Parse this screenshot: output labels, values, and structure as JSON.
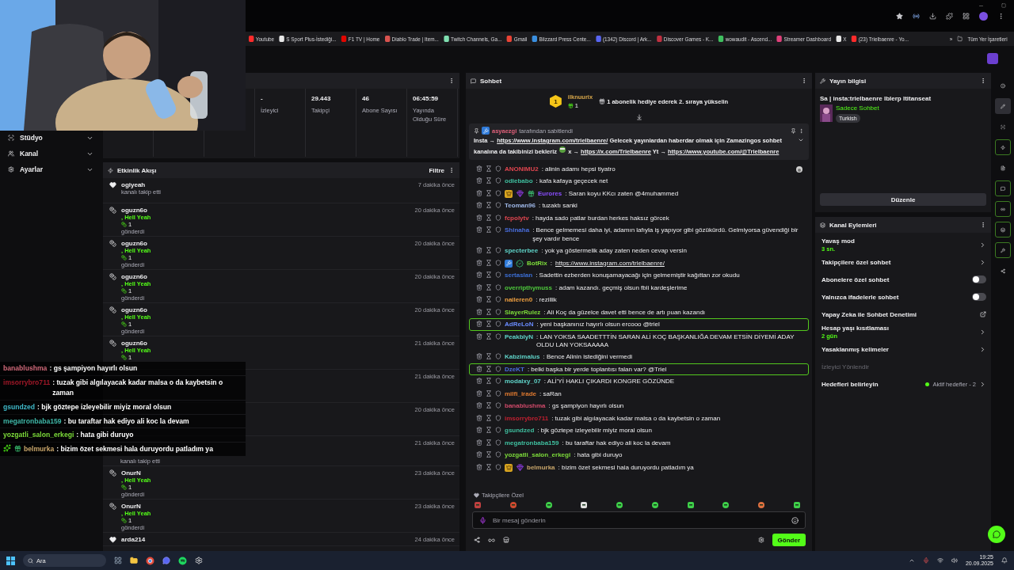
{
  "browser": {
    "bookmarks": [
      {
        "label": "Youtube",
        "color": "#ff2b2b"
      },
      {
        "label": "S Sport Plus-İstediği...",
        "color": "#e8e8e8"
      },
      {
        "label": "F1 TV | Home",
        "color": "#e10600"
      },
      {
        "label": "Diablo Trade | Item...",
        "color": "#d9534f"
      },
      {
        "label": "Twitch Channels, Ga...",
        "color": "#7fdfb0"
      },
      {
        "label": "Gmail",
        "color": "#ea4335"
      },
      {
        "label": "Blizzard Press Cente...",
        "color": "#3a8fe0"
      },
      {
        "label": "(1342) Discord | Ark...",
        "color": "#5865f2"
      },
      {
        "label": "Discover Games - K...",
        "color": "#c03040"
      },
      {
        "label": "wowaudit - Ascend...",
        "color": "#3fbf5f"
      },
      {
        "label": "Streamer Dashboard",
        "color": "#e0407a"
      },
      {
        "label": "X",
        "color": "#e8e8e8"
      },
      {
        "label": "(23) Trielbaenre - Yo...",
        "color": "#ff2b2b"
      }
    ],
    "more": "»",
    "all_bookmarks": "Tüm Yer İşaretleri"
  },
  "nav": [
    {
      "kind": "studio",
      "label": "Stüdyo"
    },
    {
      "kind": "channel",
      "label": "Kanal"
    },
    {
      "kind": "settings",
      "label": "Ayarlar"
    }
  ],
  "stats": [
    {
      "value": "-",
      "label": "İzleyici"
    },
    {
      "value": "29.443",
      "label": "Takipçi"
    },
    {
      "value": "46",
      "label": "Abone Sayısı"
    },
    {
      "value": "06:45:59",
      "label": "Yayında Olduğu Süre"
    }
  ],
  "activity": {
    "title": "Etkinlik Akışı",
    "filter": "Filtre",
    "items": [
      {
        "kind": "follow",
        "name": "ogiyeah",
        "note": "kanalı takip etti",
        "time": "7 dakika önce"
      },
      {
        "kind": "gift",
        "name": "oguzn6o",
        "reward": ", Hell Yeah",
        "count": "1",
        "note": "gönderdi",
        "time": "20 dakika önce"
      },
      {
        "kind": "gift",
        "name": "oguzn6o",
        "reward": ", Hell Yeah",
        "count": "1",
        "note": "gönderdi",
        "time": "20 dakika önce"
      },
      {
        "kind": "gift",
        "name": "oguzn6o",
        "reward": ", Hell Yeah",
        "count": "1",
        "note": "gönderdi",
        "time": "20 dakika önce"
      },
      {
        "kind": "gift",
        "name": "oguzn6o",
        "reward": ", Hell Yeah",
        "count": "1",
        "note": "gönderdi",
        "time": "20 dakika önce"
      },
      {
        "kind": "gift",
        "name": "oguzn6o",
        "reward": ", Hell Yeah",
        "count": "1",
        "time": "21 dakika önce"
      },
      {
        "kind": "covered",
        "time": "21 dakika önce"
      },
      {
        "kind": "covered",
        "time": "20 dakika önce"
      },
      {
        "kind": "covered",
        "time": "21 dakika önce",
        "note": "kanalı takip etti"
      },
      {
        "kind": "gift",
        "name": "OnurN",
        "reward": ", Hell Yeah",
        "count": "1",
        "note": "gönderdi",
        "time": "23 dakika önce"
      },
      {
        "kind": "gift",
        "name": "OnurN",
        "reward": ", Hell Yeah",
        "count": "1",
        "note": "gönderdi",
        "time": "23 dakika önce"
      },
      {
        "kind": "cut",
        "name": "arda214",
        "time": "24 dakika önce"
      }
    ]
  },
  "chat": {
    "title": "Sohbet",
    "leader": {
      "rank": "1",
      "name": "ilknuurix",
      "count": "1",
      "prompt": "1 abonelik hediye ederek 2. sıraya yükselin"
    },
    "pinned": {
      "by": "asyaezgi",
      "note": "tarafından sabitlendi",
      "segments": [
        {
          "kind": "text",
          "text": "Insta → "
        },
        {
          "kind": "link",
          "text": "https://www.instagram.com/trielbaenre/"
        },
        {
          "kind": "text",
          "text": " Gelecek yayınlardan haberdar olmak için Zamazingos sohbet kanalına da takibinizi bekleriz "
        },
        {
          "kind": "emote"
        },
        {
          "kind": "text",
          "text": " x → "
        },
        {
          "kind": "link",
          "text": "https://x.com/Trielbaenre"
        },
        {
          "kind": "text",
          "text": " Yt → "
        },
        {
          "kind": "link",
          "text": "https://www.youtube.com/@Trielbaenre"
        }
      ]
    },
    "messages": [
      {
        "user": "ANONIMU2",
        "color": "#e0454f",
        "text": ": alinin adamı hepsi tiyatro",
        "emote": true,
        "highlighted": false
      },
      {
        "user": "odiebabo",
        "color": "#3fbf9f",
        "text": ": kafa kafaya geçecek net",
        "highlighted": false
      },
      {
        "user": "Eurores",
        "color": "#8a4dff",
        "text": ": Saran koyu KKcı zaten @4muhammed",
        "badges": [
          {
            "kind": "crown"
          },
          {
            "kind": "gem"
          },
          {
            "kind": "gift"
          }
        ],
        "highlighted": false
      },
      {
        "user": "Teoman96",
        "color": "#9fb8e8",
        "text": ": tuzaktı sanki",
        "highlighted": false
      },
      {
        "user": "fcpolytv",
        "color": "#e0454f",
        "text": ": hayda sado patlar burdan herkes haksız görcek",
        "highlighted": false
      },
      {
        "user": "Shinaha",
        "color": "#4a6fe0",
        "text": ": Bence gelmemesi daha iyi, adamın lafıyla iş yapıyor gibi gözükürdü. Gelmiyorsa güvendiği bir şey vardır bence",
        "highlighted": false
      },
      {
        "user": "specterbee",
        "color": "#5fd3c8",
        "text": ": yok ya göstermelik aday zaten neden cevap versin",
        "highlighted": false
      },
      {
        "user": "BotRix",
        "color": "#7ddc3a",
        "text": ":",
        "link": "https://www.instagram.com/trielbaenre/",
        "badges": [
          {
            "kind": "mod"
          },
          {
            "kind": "verified"
          }
        ],
        "highlighted": false
      },
      {
        "user": "sertaslan",
        "color": "#3c6fd6",
        "text": ": Sadettin ezberden konuşamayacağı için gelmemiştir kağıttan zor okudu",
        "highlighted": false
      },
      {
        "user": "overripthymuss",
        "color": "#4ec83c",
        "text": ": adam kazandı. geçmiş olsun fbli kardeşlerime",
        "highlighted": false
      },
      {
        "user": "naileren0",
        "color": "#f0a040",
        "text": ": rezillik",
        "highlighted": false
      },
      {
        "user": "SlayerRulez",
        "color": "#7ddc3a",
        "text": ": Ali Koç da güzelce davet etti bence de artı puan kazandı",
        "highlighted": false
      },
      {
        "user": "AdReLoN",
        "color": "#6a8cff",
        "text": ": yeni başkanınız hayırlı olsun ercooo @triel",
        "highlighted": true
      },
      {
        "user": "PeakblyN",
        "color": "#5fd3c8",
        "text": ": LAN YOKSA SAADETTTİN SARAN ALİ KOÇ BAŞKANLIĞA DEVAM ETSİN DİYEMİ ADAY OLDU LAN YOKSAAAAA",
        "highlighted": false
      },
      {
        "user": "Kabzimalus",
        "color": "#5fd3c8",
        "text": ": Bence Alinin istediğini vermedi",
        "highlighted": false
      },
      {
        "user": "DzeKT",
        "color": "#4a6fe0",
        "text": ": belki başka bir yerde toplantısı falan var? @Triel",
        "highlighted": true
      },
      {
        "user": "modalxy_07",
        "color": "#5fd3c8",
        "text": ": ALİ'Yİ HAKLI ÇIKARDI KONGRE GÖZÜNDE",
        "highlighted": false
      },
      {
        "user": "milfi_irade",
        "color": "#e07a30",
        "text": ": saRan",
        "highlighted": false
      },
      {
        "user": "banablushma",
        "color": "#d04a6a",
        "text": ": gs şampiyon hayırlı olsun",
        "highlighted": false
      },
      {
        "user": "imsorrybro711",
        "color": "#c02030",
        "text": ": tuzak gibi algılayacak kadar malsa o da kaybetsin o zaman",
        "highlighted": false
      },
      {
        "user": "gsundzed",
        "color": "#3fbf9f",
        "text": ": bjk göztepe izleyebilir miyiz moral olsun",
        "highlighted": false
      },
      {
        "user": "megatronbaba159",
        "color": "#3fbf9f",
        "text": ": bu taraftar hak ediyo ali koc la devam",
        "highlighted": false
      },
      {
        "user": "yozgatli_salon_erkegi",
        "color": "#7ddc3a",
        "text": ": hata gibi duruyo",
        "highlighted": false
      },
      {
        "user": "belmurka",
        "color": "#c9a66b",
        "text": ": bizim özet sekmesi hala duruyordu patladım ya",
        "badges": [
          {
            "kind": "crown"
          },
          {
            "kind": "gem"
          }
        ],
        "highlighted": false
      }
    ],
    "emote_label": "Takipçilere Özel",
    "input": {
      "placeholder": "Bir mesaj gönderin"
    },
    "send": "Gönder"
  },
  "stream_info": {
    "title": "Yayın bilgisi",
    "stream_title": "Sa | insta:trielbaenre lblerp ltitanseat",
    "category": "Sadece Sohbet",
    "tag": "Turkish",
    "edit": "Düzenle"
  },
  "channel_actions": {
    "title": "Kanal Eylemleri",
    "items": [
      {
        "kind": "nav",
        "label": "Yavaş mod",
        "value": "3 sn."
      },
      {
        "kind": "nav",
        "label": "Takipçilere özel sohbet"
      },
      {
        "kind": "toggle",
        "label": "Abonelere özel sohbet",
        "on": false
      },
      {
        "kind": "toggle",
        "label": "Yalnızca ifadelerle sohbet",
        "on": false
      },
      {
        "kind": "external",
        "label": "Yapay Zeka ile Sohbet Denetimi"
      },
      {
        "kind": "nav",
        "label": "Hesap yaşı kısıtlaması",
        "value": "2 gün"
      },
      {
        "kind": "nav",
        "label": "Yasaklanmış kelimeler"
      },
      {
        "kind": "disabled",
        "label": "İzleyici Yönlendir"
      },
      {
        "kind": "goal",
        "label": "Hedefleri belirleyin",
        "value": "Aktif hedefler - 2"
      }
    ]
  },
  "rail": [
    {
      "kind": "info",
      "selected": false,
      "on": false
    },
    {
      "kind": "pencil",
      "selected": true,
      "on": false
    },
    {
      "kind": "scan",
      "selected": false,
      "on": false
    },
    {
      "kind": "bolt",
      "selected": false,
      "on": true
    },
    {
      "kind": "doc",
      "selected": false,
      "on": false
    },
    {
      "kind": "chat",
      "selected": false,
      "on": true
    },
    {
      "kind": "link",
      "selected": false,
      "on": true
    },
    {
      "kind": "channel",
      "selected": false,
      "on": true
    },
    {
      "kind": "wrench",
      "selected": false,
      "on": true
    },
    {
      "kind": "share",
      "selected": false,
      "on": false
    }
  ],
  "overlay_chat": [
    {
      "user": "banablushma",
      "color": "#d06a7a",
      "text": " : gs şampiyon hayırlı olsun"
    },
    {
      "user": "imsorrybro711",
      "color": "#a01828",
      "text": " : tuzak gibi algılayacak kadar malsa o da kaybetsin o zaman"
    },
    {
      "user": "gsundzed",
      "color": "#3fb8c8",
      "text": " : bjk göztepe izleyebilir miyiz moral olsun"
    },
    {
      "user": "megatronbaba159",
      "color": "#3fb8a8",
      "text": " : bu taraftar hak ediyo ali koc la devam"
    },
    {
      "user": "yozgatli_salon_erkegi",
      "color": "#7ddc3a",
      "text": " : hata gibi duruyo"
    },
    {
      "user": "belmurka",
      "color": "#c9a66b",
      "text": " : bizim özet sekmesi hala duruyordu patladım ya",
      "badges": [
        {
          "kind": "star"
        },
        {
          "kind": "gift"
        }
      ]
    }
  ],
  "taskbar": {
    "search": "Ara",
    "time": "19:25",
    "date": "20.09.2025"
  }
}
